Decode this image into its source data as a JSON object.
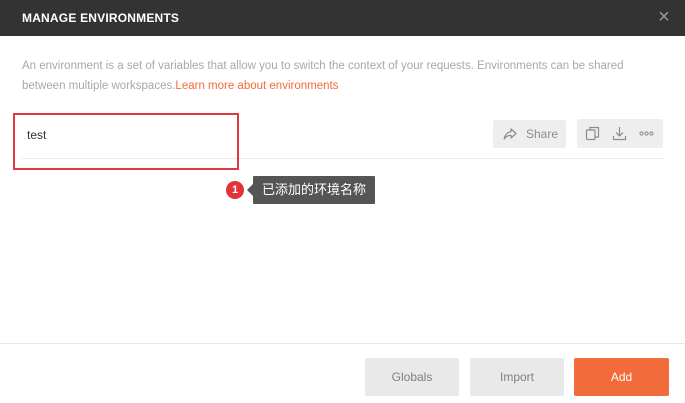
{
  "modal": {
    "title": "MANAGE ENVIRONMENTS",
    "close_glyph": "×"
  },
  "description": {
    "text": "An environment is a set of variables that allow you to switch the context of your requests. Environments can be shared between multiple workspaces.",
    "link": "Learn more about environments"
  },
  "environments": [
    {
      "name": "test"
    }
  ],
  "row_actions": {
    "share_label": "Share",
    "icons": [
      "share-arrow-icon",
      "duplicate-icon",
      "download-icon",
      "more-icon"
    ]
  },
  "annotation": {
    "badge": "1",
    "tooltip": "已添加的环境名称"
  },
  "footer": {
    "globals_label": "Globals",
    "import_label": "Import",
    "add_label": "Add"
  },
  "colors": {
    "header_bg": "#333333",
    "accent": "#f26b3a",
    "highlight": "#e0383e",
    "tooltip_bg": "#555555"
  }
}
